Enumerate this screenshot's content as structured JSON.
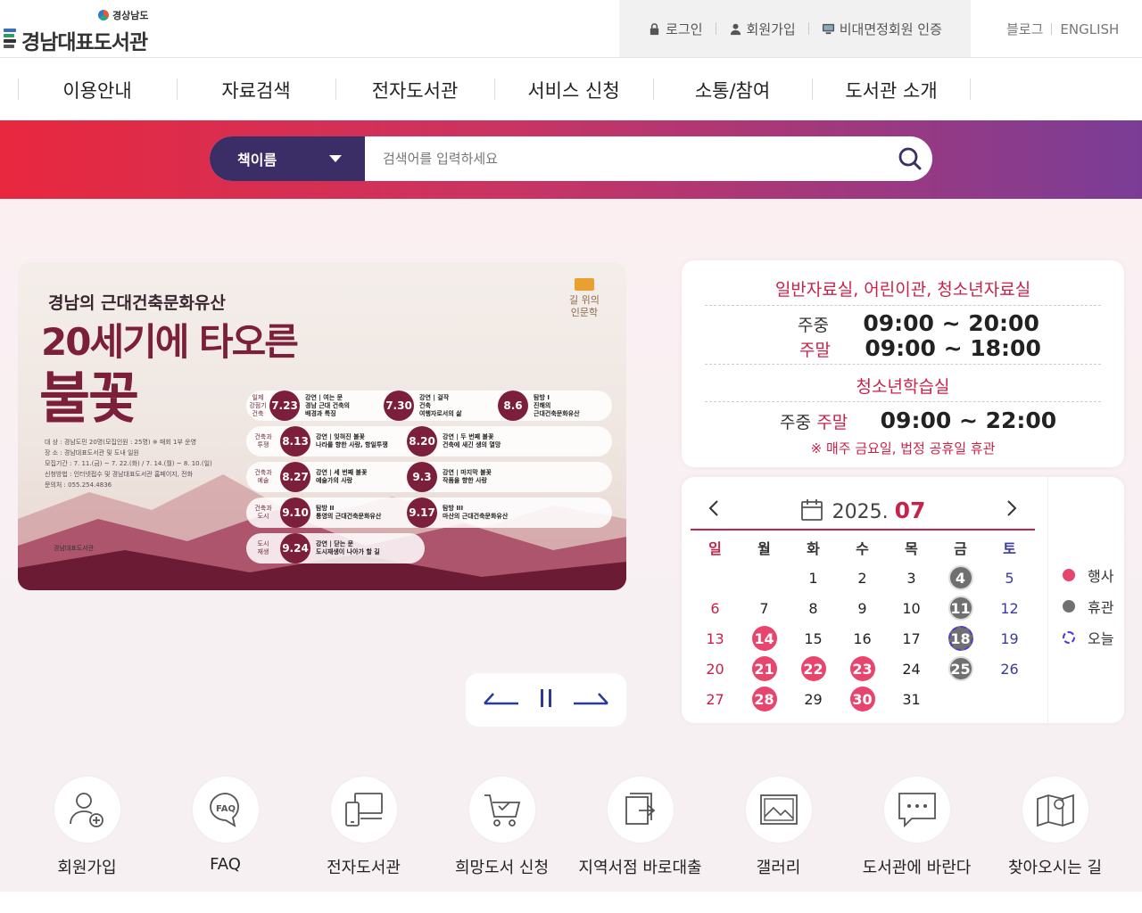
{
  "header": {
    "logo_sub": "경상남도",
    "logo_main": "경남대표도서관",
    "util": [
      {
        "label": "로그인",
        "icon": "lock-icon"
      },
      {
        "label": "회원가입",
        "icon": "person-icon"
      },
      {
        "label": "비대면정회원 인증",
        "icon": "monitor-icon"
      }
    ],
    "lang": {
      "blog": "블로그",
      "english": "ENGLISH"
    }
  },
  "gnb": [
    "이용안내",
    "자료검색",
    "전자도서관",
    "서비스 신청",
    "소통/참여",
    "도서관 소개"
  ],
  "search": {
    "select_value": "책이름",
    "placeholder": "검색어를 입력하세요"
  },
  "banner": {
    "sub": "경남의 근대건축문화유산",
    "title1": "20세기에 타오른",
    "title2": "불꽃",
    "badge": "길 위의\n인문학",
    "info": [
      "대   상 : 경남도민 20명(모집인원 : 25명) ※ 매회 1부 운영",
      "장   소 : 경남대표도서관 및 도내 일원",
      "모집기간 : 7. 11.(금) ~ 7. 22.(화) / 7. 14.(월) ~ 8. 10.(일)",
      "신청방법 : 인터넷접수 및 경남대표도서관 홈페이지, 전화",
      "문의처 : 055.254.4836"
    ],
    "footer": "경남대표도서관",
    "events": [
      {
        "cat": "일제\n강점기\n건축",
        "items": [
          {
            "date": "7.23",
            "text": "강연 | 여는 문\n경남 근대 건축의\n배경과 특징"
          },
          {
            "date": "7.30",
            "text": "강연 | 걸작\n건축\n여행자로서의 삶"
          },
          {
            "date": "8.6",
            "text": "탐방 I\n진해의\n근대건축문화유산"
          }
        ]
      },
      {
        "cat": "건축과\n투쟁",
        "items": [
          {
            "date": "8.13",
            "text": "강연 | 잊혀진 불꽃\n나라를 향한 사랑, 항일투쟁"
          },
          {
            "date": "8.20",
            "text": "강연 | 두 번째 불꽃\n건축에 새긴 생의 열망"
          }
        ]
      },
      {
        "cat": "건축과\n예술",
        "items": [
          {
            "date": "8.27",
            "text": "강연 | 세 번째 불꽃\n예술가의 사랑"
          },
          {
            "date": "9.3",
            "text": "강연 | 마지막 불꽃\n작품을 향한 사랑"
          }
        ]
      },
      {
        "cat": "건축과\n도시",
        "items": [
          {
            "date": "9.10",
            "text": "탐방 II\n통영의 근대건축문화유산"
          },
          {
            "date": "9.17",
            "text": "탐방 III\n마산의 근대건축문화유산"
          }
        ]
      },
      {
        "cat": "도시\n재생",
        "items": [
          {
            "date": "9.24",
            "text": "강연 | 닫는 문\n도시재생이 나아가 할 길"
          }
        ]
      }
    ]
  },
  "hours": {
    "title1": "일반자료실, 어린이관, 청소년자료실",
    "weekday_label": "주중",
    "weekday_time": "09:00 ~ 20:00",
    "weekend_label": "주말",
    "weekend_time": "09:00 ~ 18:00",
    "title2": "청소년학습실",
    "row2_label_a": "주중",
    "row2_label_b": "주말",
    "row2_time": "09:00 ~ 22:00",
    "note": "※ 매주 금요일, 법정 공휴일 휴관"
  },
  "calendar": {
    "year": "2025.",
    "month": "07",
    "weekdays": [
      "일",
      "월",
      "화",
      "수",
      "목",
      "금",
      "토"
    ],
    "weeks": [
      [
        "",
        "",
        "1",
        "2",
        "3",
        "4",
        "5"
      ],
      [
        "6",
        "7",
        "8",
        "9",
        "10",
        "11",
        "12"
      ],
      [
        "13",
        "14",
        "15",
        "16",
        "17",
        "18",
        "19"
      ],
      [
        "20",
        "21",
        "22",
        "23",
        "24",
        "25",
        "26"
      ],
      [
        "27",
        "28",
        "29",
        "30",
        "31",
        "",
        ""
      ]
    ],
    "event_days": [
      "14",
      "21",
      "22",
      "23",
      "28",
      "30"
    ],
    "closed_days": [
      "4",
      "11",
      "18",
      "25"
    ],
    "today": "18",
    "legend": [
      {
        "label": "행사",
        "color": "#e8456e"
      },
      {
        "label": "휴관",
        "color": "#707070"
      },
      {
        "label": "오늘",
        "color": "#4a3ae0"
      }
    ]
  },
  "quick": [
    {
      "label": "회원가입",
      "icon": "user-add-icon"
    },
    {
      "label": "FAQ",
      "icon": "faq-icon"
    },
    {
      "label": "전자도서관",
      "icon": "devices-icon"
    },
    {
      "label": "희망도서 신청",
      "icon": "cart-icon"
    },
    {
      "label": "지역서점 바로대출",
      "icon": "book-export-icon"
    },
    {
      "label": "갤러리",
      "icon": "gallery-icon"
    },
    {
      "label": "도서관에 바란다",
      "icon": "chat-icon"
    },
    {
      "label": "찾아오시는 길",
      "icon": "map-icon"
    }
  ]
}
